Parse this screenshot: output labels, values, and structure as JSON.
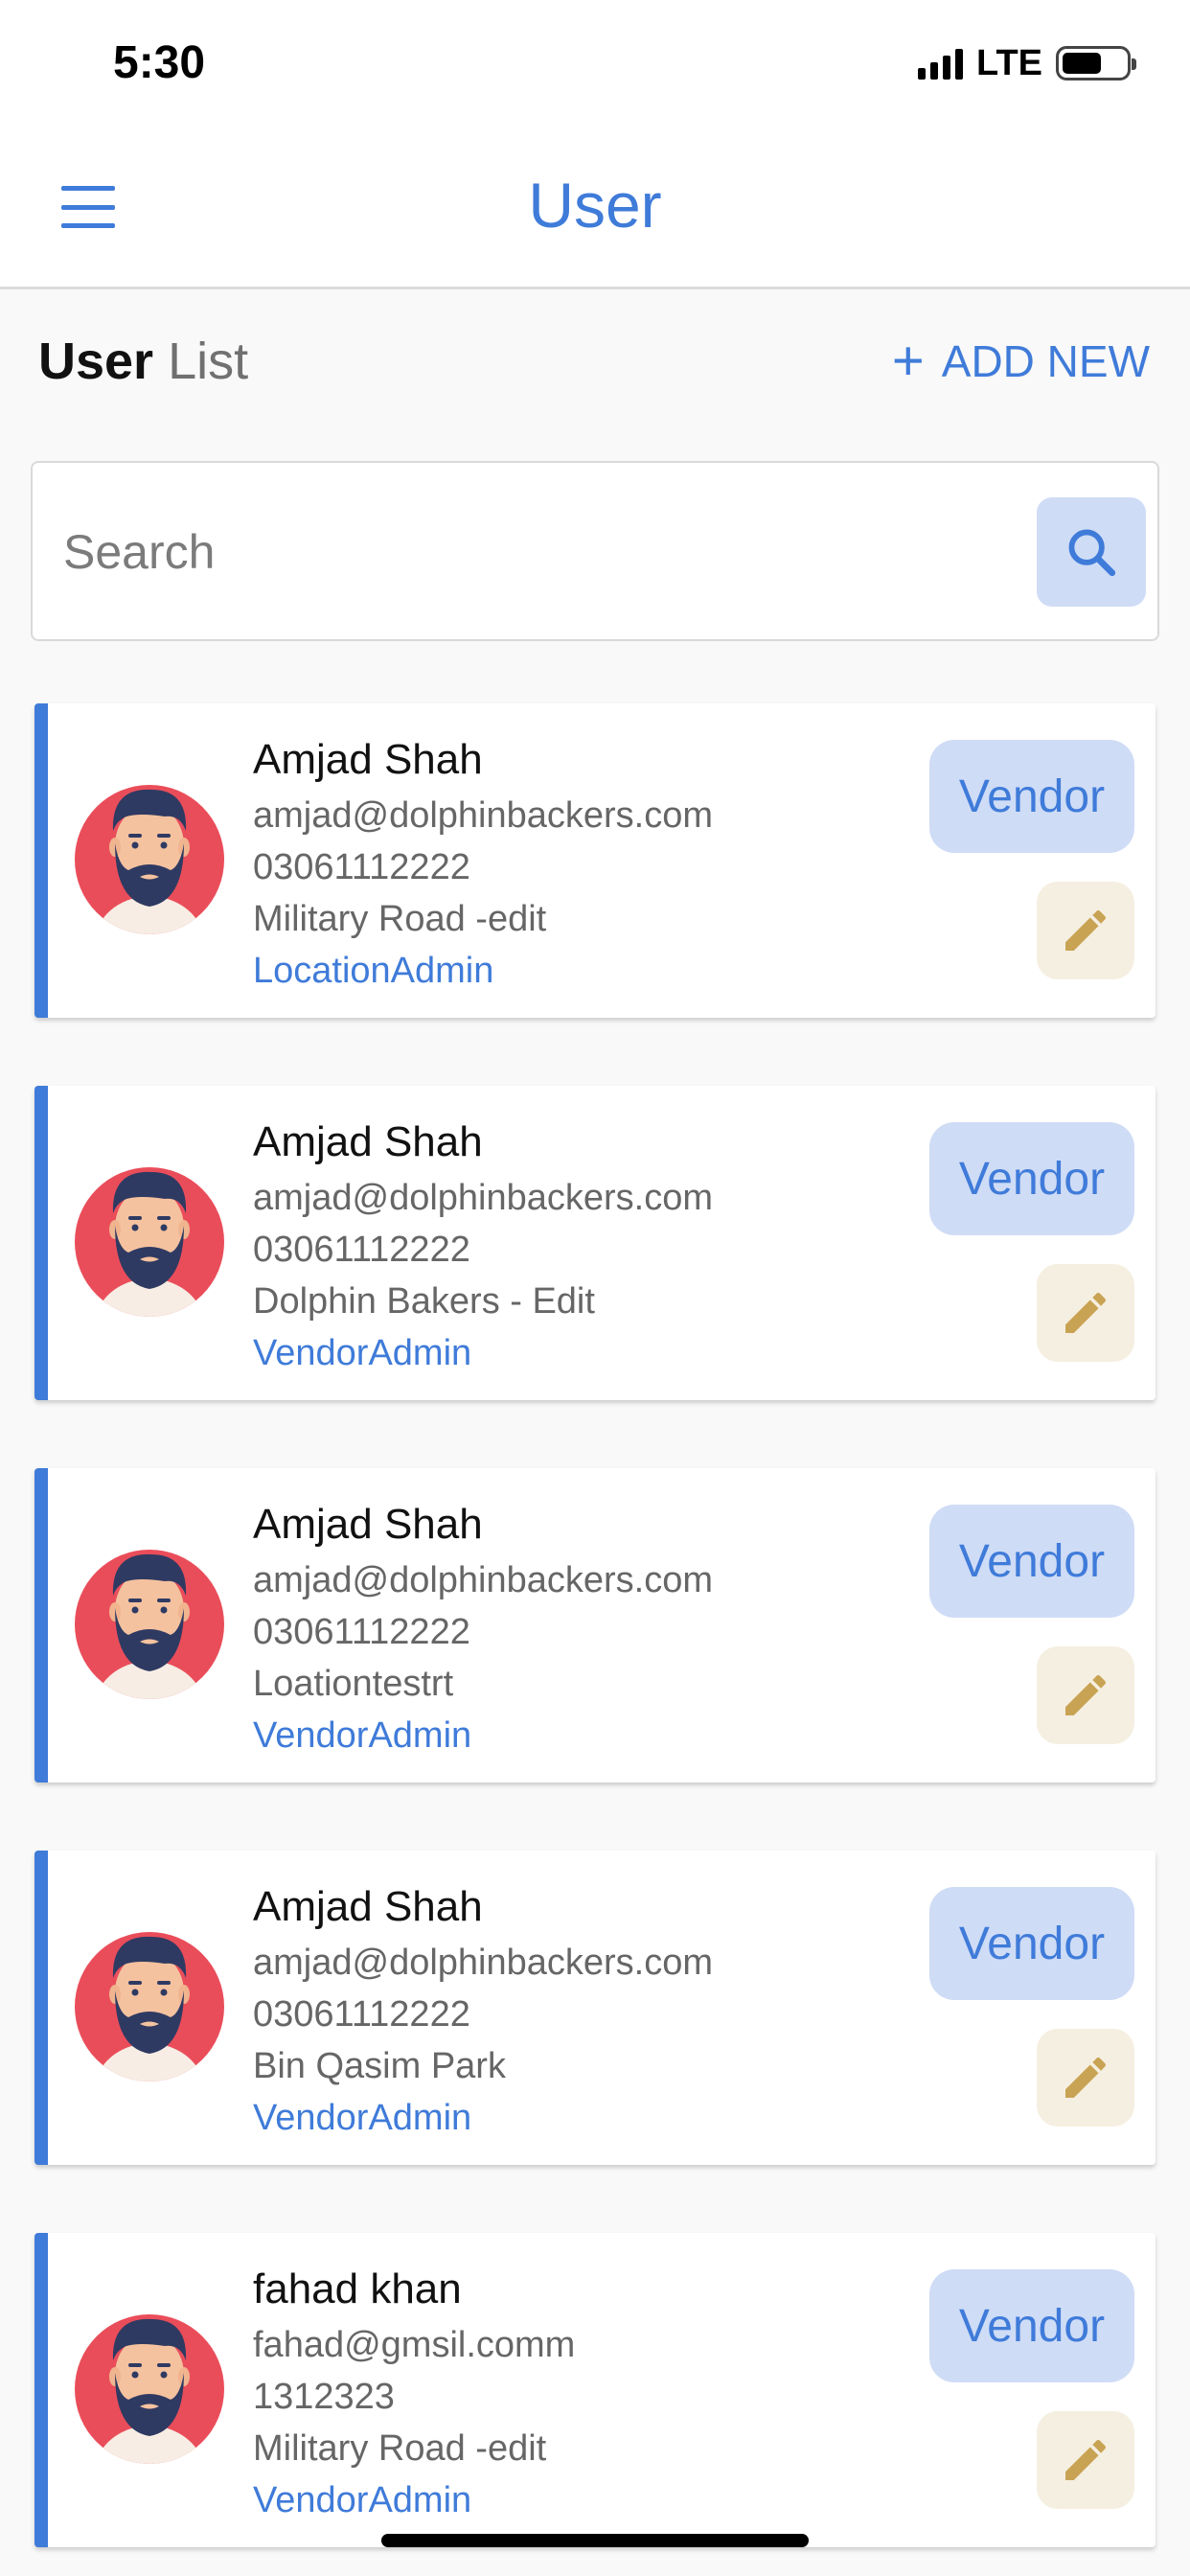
{
  "status_bar": {
    "time": "5:30",
    "network": "LTE"
  },
  "nav": {
    "title": "User"
  },
  "list_header": {
    "title_strong": "User",
    "title_light": "List",
    "add_new_label": "ADD NEW"
  },
  "search": {
    "placeholder": "Search"
  },
  "users": [
    {
      "name": "Amjad Shah",
      "email": "amjad@dolphinbackers.com",
      "phone": "03061112222",
      "location": "Military Road -edit",
      "role": "LocationAdmin",
      "badge": "Vendor"
    },
    {
      "name": "Amjad Shah",
      "email": "amjad@dolphinbackers.com",
      "phone": "03061112222",
      "location": "Dolphin Bakers - Edit",
      "role": "VendorAdmin",
      "badge": "Vendor"
    },
    {
      "name": "Amjad Shah",
      "email": "amjad@dolphinbackers.com",
      "phone": "03061112222",
      "location": "Loationtestrt",
      "role": "VendorAdmin",
      "badge": "Vendor"
    },
    {
      "name": "Amjad Shah",
      "email": "amjad@dolphinbackers.com",
      "phone": "03061112222",
      "location": "Bin Qasim Park",
      "role": "VendorAdmin",
      "badge": "Vendor"
    },
    {
      "name": "fahad khan",
      "email": "fahad@gmsil.comm",
      "phone": "1312323",
      "location": "Military Road -edit",
      "role": "VendorAdmin",
      "badge": "Vendor"
    }
  ],
  "icons": {
    "menu": "hamburger-menu-icon",
    "search": "search-icon",
    "add": "plus-icon",
    "edit": "pencil-icon",
    "avatar": "bearded-man-avatar"
  },
  "colors": {
    "accent": "#3f7bd9",
    "badge_bg": "#cfdcf6",
    "edit_bg": "#f5efe1",
    "edit_icon": "#c9a354",
    "avatar_bg": "#ea4d5a"
  }
}
